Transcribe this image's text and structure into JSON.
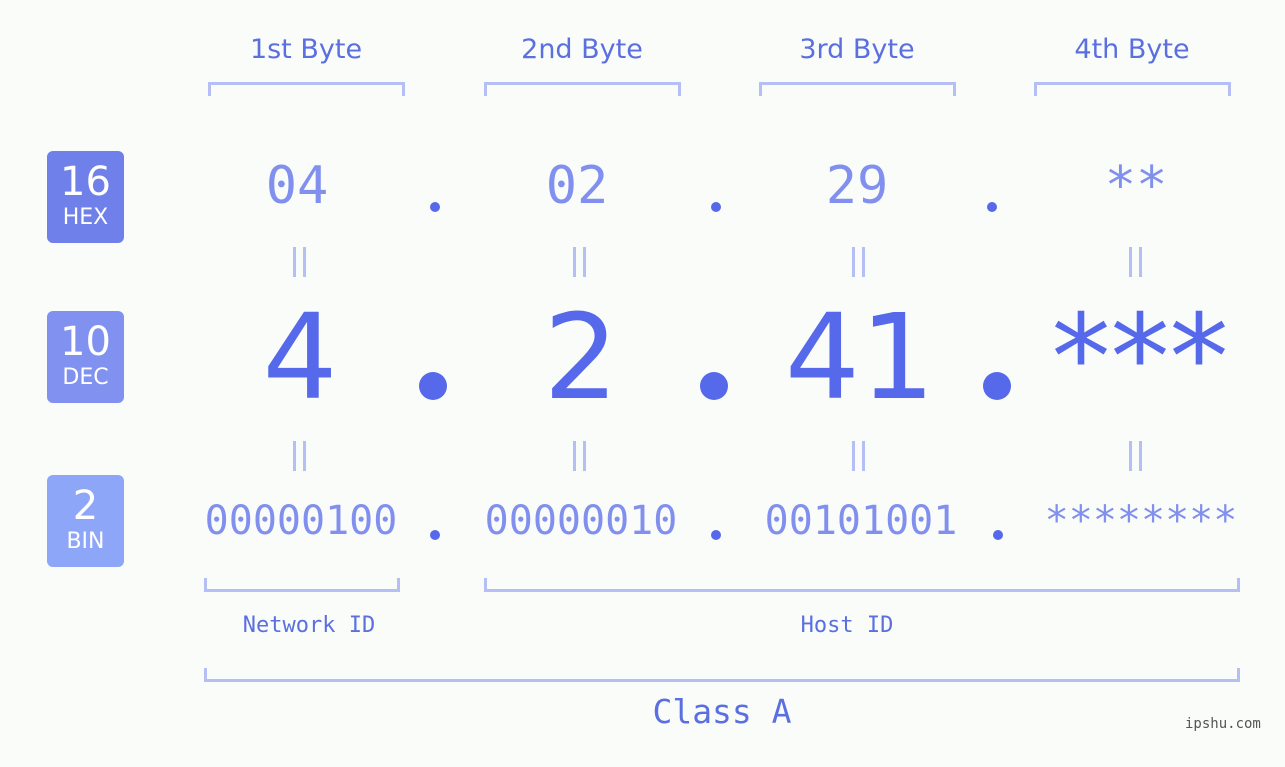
{
  "badges": [
    {
      "number": "16",
      "label": "HEX",
      "color": "#7080ea"
    },
    {
      "number": "10",
      "label": "DEC",
      "color": "#8191f0"
    },
    {
      "number": "2",
      "label": "BIN",
      "color": "#8ea6f8"
    }
  ],
  "bytes": [
    {
      "header": "1st Byte",
      "hex": "04",
      "dec": "4",
      "bin": "00000100"
    },
    {
      "header": "2nd Byte",
      "hex": "02",
      "dec": "2",
      "bin": "00000010"
    },
    {
      "header": "3rd Byte",
      "hex": "29",
      "dec": "41",
      "bin": "00101001"
    },
    {
      "header": "4th Byte",
      "hex": "**",
      "dec": "***",
      "bin": "********"
    }
  ],
  "separators": {
    "hex": ".",
    "dec": ".",
    "bin": "."
  },
  "segments": {
    "network_id": "Network ID",
    "host_id": "Host ID"
  },
  "ip_class": "Class A",
  "watermark": "ipshu.com",
  "colors": {
    "accent": "#5569ea",
    "light_accent": "#8190ee",
    "bracket": "#b5bff5"
  }
}
